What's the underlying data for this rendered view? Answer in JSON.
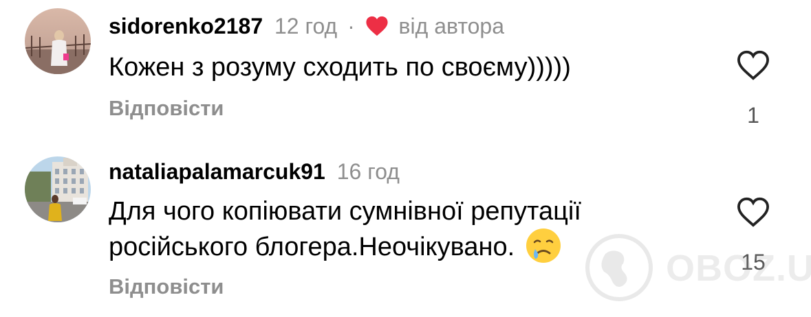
{
  "comments": [
    {
      "username": "sidorenko2187",
      "time": "12 год",
      "separator": "·",
      "author_like": "від автора",
      "text": "Кожен з розуму сходить по своєму)))))",
      "reply_label": "Відповісти",
      "like_count": "1"
    },
    {
      "username": "nataliapalamarcuk91",
      "time": "16 год",
      "text_line1": "Для чого копіювати сумнівної репутації",
      "text_line2": "російського блогера.Неочікувано.",
      "reply_label": "Відповісти",
      "like_count": "15"
    }
  ],
  "watermark": {
    "text": "OBOZ.UA"
  },
  "colors": {
    "heart_red": "#ed2f45",
    "meta_gray": "#8e8e8e",
    "text_black": "#000000"
  },
  "icons": {
    "like": "heart-outline-icon",
    "author_like": "heart-filled-icon",
    "emoji": "crying-face-emoji"
  }
}
